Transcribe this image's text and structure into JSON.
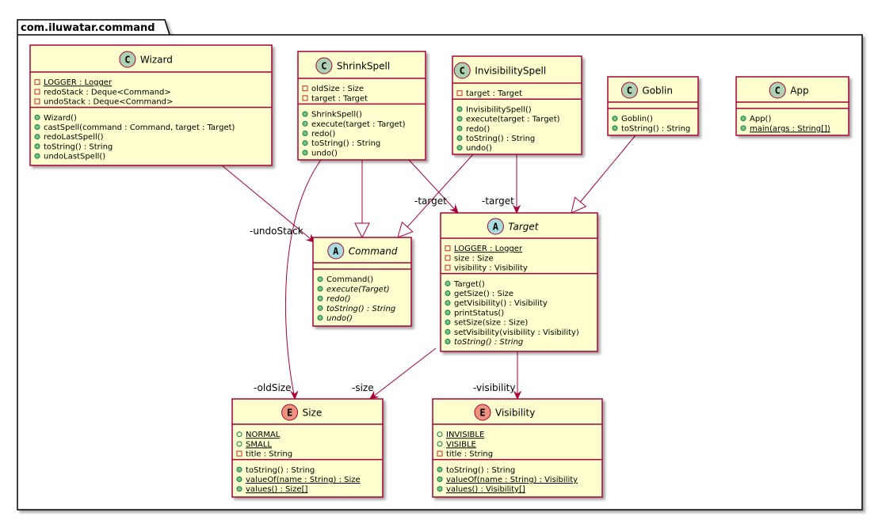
{
  "package": {
    "title": "com.iluwatar.command"
  },
  "classes": {
    "wizard": {
      "kind": "C",
      "name": "Wizard",
      "fields": [
        {
          "vis": "-",
          "text": "LOGGER : Logger",
          "static": true
        },
        {
          "vis": "-",
          "text": "redoStack : Deque<Command>"
        },
        {
          "vis": "-",
          "text": "undoStack : Deque<Command>"
        }
      ],
      "methods": [
        {
          "vis": "+",
          "text": "Wizard()"
        },
        {
          "vis": "+",
          "text": "castSpell(command : Command, target : Target)"
        },
        {
          "vis": "+",
          "text": "redoLastSpell()"
        },
        {
          "vis": "+",
          "text": "toString() : String"
        },
        {
          "vis": "+",
          "text": "undoLastSpell()"
        }
      ]
    },
    "shrinkspell": {
      "kind": "C",
      "name": "ShrinkSpell",
      "fields": [
        {
          "vis": "-",
          "text": "oldSize : Size"
        },
        {
          "vis": "-",
          "text": "target : Target"
        }
      ],
      "methods": [
        {
          "vis": "+",
          "text": "ShrinkSpell()"
        },
        {
          "vis": "+",
          "text": "execute(target : Target)"
        },
        {
          "vis": "+",
          "text": "redo()"
        },
        {
          "vis": "+",
          "text": "toString() : String"
        },
        {
          "vis": "+",
          "text": "undo()"
        }
      ]
    },
    "invisibilityspell": {
      "kind": "C",
      "name": "InvisibilitySpell",
      "fields": [
        {
          "vis": "-",
          "text": "target : Target"
        }
      ],
      "methods": [
        {
          "vis": "+",
          "text": "InvisibilitySpell()"
        },
        {
          "vis": "+",
          "text": "execute(target : Target)"
        },
        {
          "vis": "+",
          "text": "redo()"
        },
        {
          "vis": "+",
          "text": "toString() : String"
        },
        {
          "vis": "+",
          "text": "undo()"
        }
      ]
    },
    "goblin": {
      "kind": "C",
      "name": "Goblin",
      "fields": [],
      "methods": [
        {
          "vis": "+",
          "text": "Goblin()"
        },
        {
          "vis": "+",
          "text": "toString() : String"
        }
      ]
    },
    "app": {
      "kind": "C",
      "name": "App",
      "fields": [],
      "methods": [
        {
          "vis": "+",
          "text": "App()"
        },
        {
          "vis": "+",
          "text": "main(args : String[])",
          "static": true
        }
      ]
    },
    "command": {
      "kind": "A",
      "name": "Command",
      "abstract": true,
      "fields": [],
      "methods": [
        {
          "vis": "+",
          "text": "Command()"
        },
        {
          "vis": "+",
          "text": "execute(Target)",
          "abstract": true
        },
        {
          "vis": "+",
          "text": "redo()",
          "abstract": true
        },
        {
          "vis": "+",
          "text": "toString() : String",
          "abstract": true
        },
        {
          "vis": "+",
          "text": "undo()",
          "abstract": true
        }
      ]
    },
    "target": {
      "kind": "A",
      "name": "Target",
      "abstract": true,
      "fields": [
        {
          "vis": "-",
          "text": "LOGGER : Logger",
          "static": true
        },
        {
          "vis": "-",
          "text": "size : Size"
        },
        {
          "vis": "-",
          "text": "visibility : Visibility"
        }
      ],
      "methods": [
        {
          "vis": "+",
          "text": "Target()"
        },
        {
          "vis": "+",
          "text": "getSize() : Size"
        },
        {
          "vis": "+",
          "text": "getVisibility() : Visibility"
        },
        {
          "vis": "+",
          "text": "printStatus()"
        },
        {
          "vis": "+",
          "text": "setSize(size : Size)"
        },
        {
          "vis": "+",
          "text": "setVisibility(visibility : Visibility)"
        },
        {
          "vis": "+",
          "text": "toString() : String",
          "abstract": true
        }
      ]
    },
    "size": {
      "kind": "E",
      "name": "Size",
      "fields": [
        {
          "vis": "+",
          "text": "NORMAL",
          "static": true
        },
        {
          "vis": "+",
          "text": "SMALL",
          "static": true
        },
        {
          "vis": "-",
          "text": "title : String"
        }
      ],
      "methods": [
        {
          "vis": "+",
          "text": "toString() : String"
        },
        {
          "vis": "+",
          "text": "valueOf(name : String) : Size",
          "static": true
        },
        {
          "vis": "+",
          "text": "values() : Size[]",
          "static": true
        }
      ]
    },
    "visibility": {
      "kind": "E",
      "name": "Visibility",
      "fields": [
        {
          "vis": "+",
          "text": "INVISIBLE",
          "static": true
        },
        {
          "vis": "+",
          "text": "VISIBLE",
          "static": true
        },
        {
          "vis": "-",
          "text": "title : String"
        }
      ],
      "methods": [
        {
          "vis": "+",
          "text": "toString() : String"
        },
        {
          "vis": "+",
          "text": "valueOf(name : String) : Visibility",
          "static": true
        },
        {
          "vis": "+",
          "text": "values() : Visibility[]",
          "static": true
        }
      ]
    }
  },
  "edge_labels": {
    "undoStack": "-undoStack",
    "shrink_target": "-target",
    "invis_target": "-target",
    "oldSize": "-oldSize",
    "size": "-size",
    "visibility": "-visibility"
  },
  "colors": {
    "class_fill": "#FEFECE",
    "class_border": "#A80036",
    "class_circle": "#ADD1B2",
    "abstract_circle": "#A9DCDF",
    "enum_circle": "#EB937F",
    "package_border": "#000000"
  }
}
